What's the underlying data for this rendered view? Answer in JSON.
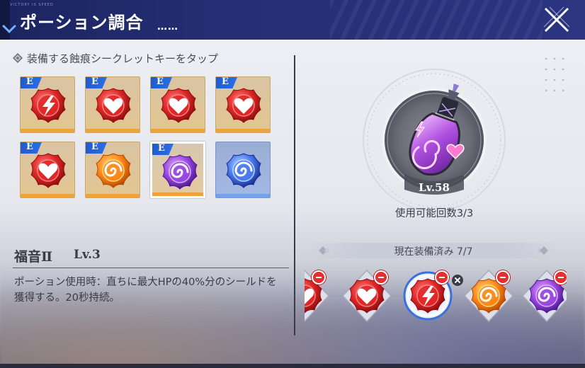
{
  "header": {
    "title": "ポーション調合",
    "title_dots": "……",
    "tiny_text": "VICTORY IS SPEED"
  },
  "left": {
    "instruction": "装備する蝕痕シークレットキーをタップ",
    "slots": [
      {
        "badge": "E",
        "gem": "lightning-red",
        "frame": "gold",
        "selected": false
      },
      {
        "badge": "E",
        "gem": "heart-red",
        "frame": "gold",
        "selected": false
      },
      {
        "badge": "E",
        "gem": "heart-red",
        "frame": "gold",
        "selected": false
      },
      {
        "badge": "E",
        "gem": "heart-red",
        "frame": "gold",
        "selected": false
      },
      {
        "badge": "E",
        "gem": "heart-red",
        "frame": "gold",
        "selected": false
      },
      {
        "badge": "E",
        "gem": "swirl-orange",
        "frame": "gold",
        "selected": false
      },
      {
        "badge": "E",
        "gem": "swirl-purple",
        "frame": "gold",
        "selected": true
      },
      {
        "badge": "",
        "gem": "swirl-blue",
        "frame": "blue",
        "selected": false
      }
    ],
    "skill_name": "福音Ⅱ",
    "skill_level": "Lv.3",
    "description": "ポーション使用時：直ちに最大HPの40%分のシールドを獲得する。20秒持続。"
  },
  "right": {
    "potion_level": "Lv.58",
    "uses": "使用可能回数3/3",
    "equipped_label": "現在装備済み 7/7",
    "equipped": [
      {
        "gem": "heart-red"
      },
      {
        "gem": "heart-red"
      },
      {
        "gem": "lightning-red",
        "highlighted": true
      },
      {
        "gem": "swirl-orange"
      },
      {
        "gem": "swirl-purple"
      }
    ]
  },
  "colors": {
    "header_bg": "#252f74",
    "accent_blue": "#2a6fe8",
    "slot_gold": "#f0a23a",
    "remove_red": "#e23030",
    "text_dark": "#3a3a48"
  }
}
